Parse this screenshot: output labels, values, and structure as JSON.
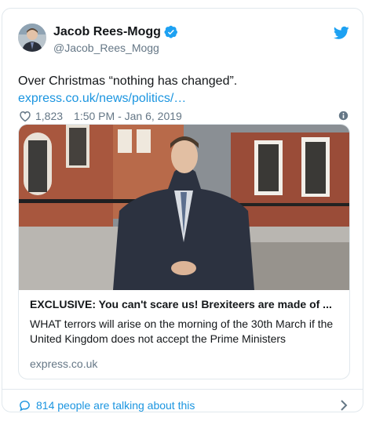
{
  "author": {
    "display_name": "Jacob Rees-Mogg",
    "handle": "@Jacob_Rees_Mogg",
    "verified": true
  },
  "tweet": {
    "text": "Over Christmas “nothing has changed”.",
    "link_text": "express.co.uk/news/politics/…"
  },
  "meta": {
    "likes": "1,823",
    "timestamp": "1:50 PM - Jan 6, 2019"
  },
  "link_card": {
    "title": "EXCLUSIVE: You can't scare us! Brexiteers are made of ...",
    "description": "WHAT terrors will arise on the morning of the 30th March if the United Kingdom does not accept the Prime Ministers",
    "domain": "express.co.uk"
  },
  "footer": {
    "talking_text": "814 people are talking about this"
  },
  "colors": {
    "link_blue": "#1b95e0",
    "verified_blue": "#1da1f2",
    "muted_gray": "#657786",
    "border": "#e1e8ed"
  },
  "icons": [
    "avatar",
    "verified-badge-icon",
    "twitter-bird-icon",
    "heart-icon",
    "info-icon",
    "reply-bubble-icon",
    "chevron-right-icon"
  ]
}
